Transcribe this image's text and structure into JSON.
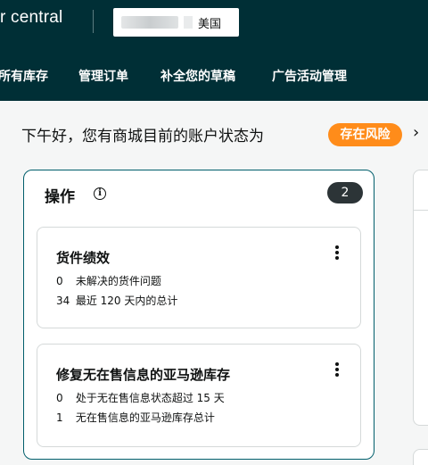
{
  "header": {
    "brand": "r central",
    "marketplace": "美国"
  },
  "nav": {
    "items": [
      "所有库存",
      "管理订单",
      "补全您的草稿",
      "广告活动管理"
    ]
  },
  "greeting": {
    "text": "下午好，您有商城目前的账户状态为",
    "status_badge": "存在风险",
    "status_color": "#ff8c1a"
  },
  "actions_panel": {
    "title": "操作",
    "count": "2",
    "cards": [
      {
        "title": "货件绩效",
        "lines": [
          {
            "num": "0",
            "text": "未解决的货件问题"
          },
          {
            "num": "34",
            "text": "最近 120 天内的总计"
          }
        ]
      },
      {
        "title": "修复无在售信息的亚马逊库存",
        "lines": [
          {
            "num": "0",
            "text": "处于无在售信息状态超过 15 天"
          },
          {
            "num": "1",
            "text": "无在售信息的亚马逊库存总计"
          }
        ]
      }
    ]
  },
  "colors": {
    "header_bg": "#002f36",
    "panel_border": "#005e6b",
    "badge_dark": "#2c3437"
  },
  "icons": [
    "info-icon",
    "more-options-icon",
    "chevron-right-icon"
  ]
}
